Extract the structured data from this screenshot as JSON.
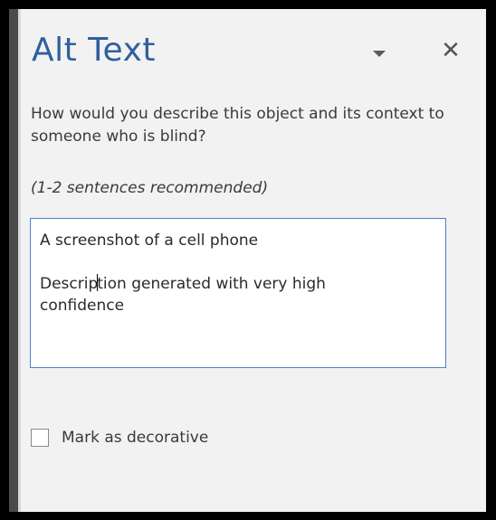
{
  "pane": {
    "title": "Alt Text",
    "options_icon": "chevron-down-icon",
    "close_glyph": "✕",
    "question": "How would you describe this object and its context to someone who is blind?",
    "recommendation": "(1-2 sentences recommended)"
  },
  "description": {
    "line1": "A screenshot of a cell phone",
    "line2_before_caret": "Descrip",
    "line2_after_caret": "tion generated with very high",
    "line3": "confidence"
  },
  "decorative": {
    "label": "Mark as decorative",
    "checked": false
  },
  "colors": {
    "title": "#2f5f9e",
    "panel_bg": "#f2f2f2",
    "textbox_border": "#4a83c6"
  }
}
